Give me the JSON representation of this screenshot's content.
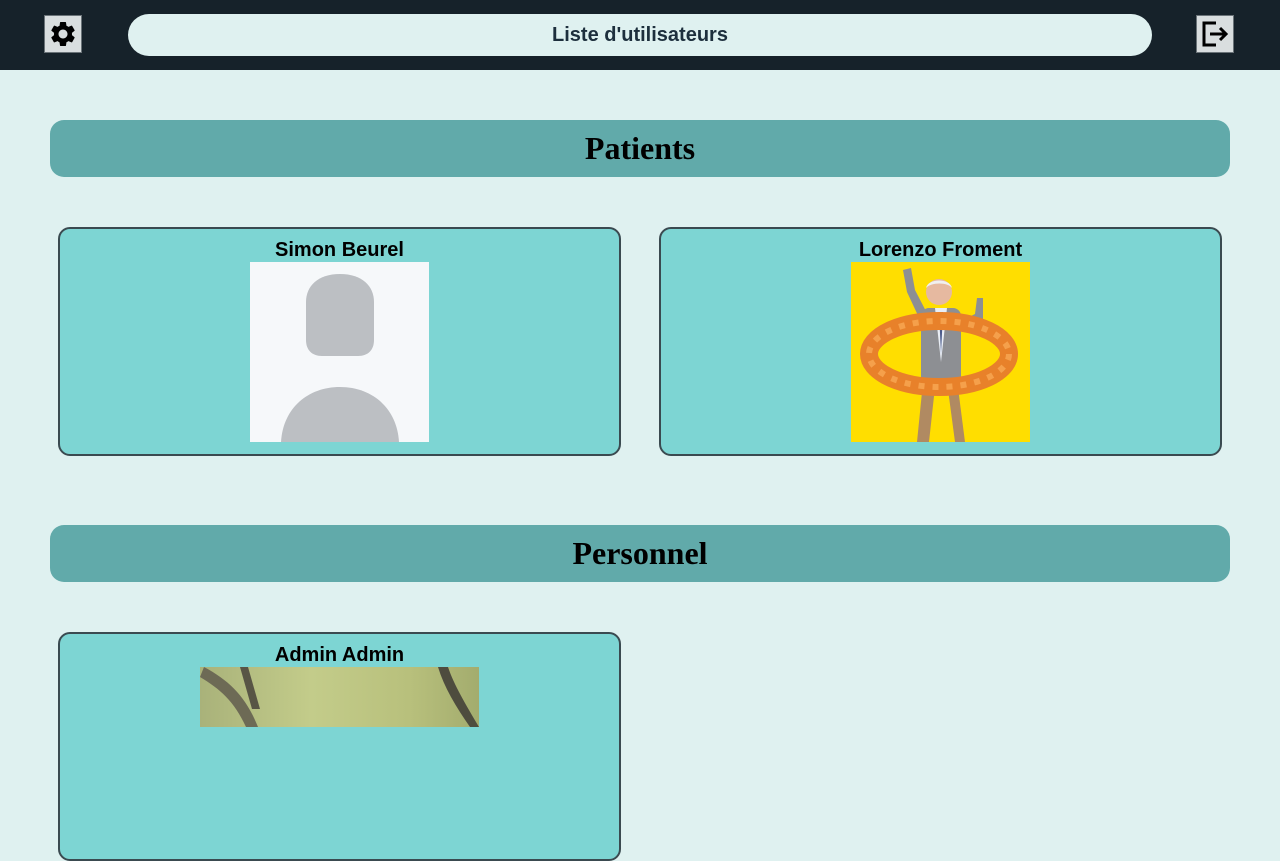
{
  "header": {
    "title": "Liste d'utilisateurs",
    "settings_icon": "gear-icon",
    "logout_icon": "logout-icon"
  },
  "sections": [
    {
      "title": "Patients",
      "users": [
        {
          "name": "Simon Beurel",
          "avatar": "default-avatar-placeholder"
        },
        {
          "name": "Lorenzo Froment",
          "avatar": "photo-man-with-pretzel-float"
        }
      ]
    },
    {
      "title": "Personnel",
      "users": [
        {
          "name": "Admin Admin",
          "avatar": "photo-bird-on-branch"
        }
      ]
    }
  ],
  "colors": {
    "topbar": "#16222a",
    "background": "#dff1f0",
    "section_header": "#61aaaa",
    "card": "#7dd5d3"
  }
}
